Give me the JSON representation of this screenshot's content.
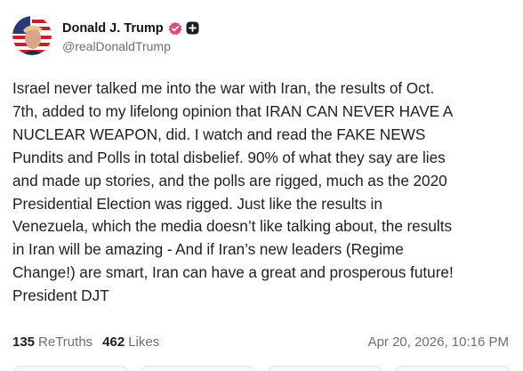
{
  "author": {
    "display_name": "Donald J. Trump",
    "handle": "@realDonaldTrump",
    "avatar_icon": "avatar-image",
    "verified_icon": "verified-badge-icon",
    "verified_color": "#e2487f",
    "extra_icon": "plus-badge-icon"
  },
  "post": {
    "lines": [
      "Israel never talked me into the war with Iran, the results of Oct.",
      "7th, added to my lifelong opinion that IRAN CAN NEVER HAVE A",
      "NUCLEAR WEAPON, did. I watch and read the FAKE NEWS",
      "Pundits and Polls in total disbelief. 90% of what they say are lies",
      "and made up stories, and the polls are rigged, much as the 2020",
      "Presidential Election was rigged. Just like the results in",
      "Venezuela, which the media doesn’t like talking about, the results",
      "in Iran will be amazing - And if Iran’s new leaders (Regime",
      "Change!) are smart, Iran can have a great and prosperous future!",
      "President DJT"
    ]
  },
  "stats": {
    "retruths_count": "135",
    "retruths_label": "ReTruths",
    "likes_count": "462",
    "likes_label": "Likes",
    "timestamp": "Apr 20, 2026, 10:16 PM"
  }
}
